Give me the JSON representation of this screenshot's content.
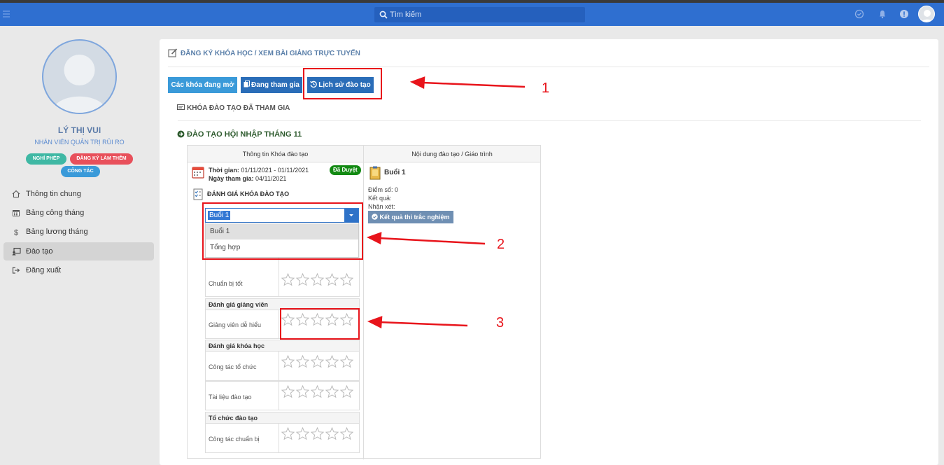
{
  "topbar": {
    "search_placeholder": "Tìm kiếm",
    "icons": [
      "menu-icon",
      "search-icon",
      "check-circle-icon",
      "bell-icon",
      "alert-icon",
      "user-avatar"
    ]
  },
  "profile": {
    "name": "LÝ THỊ VUI",
    "role": "NHÂN VIÊN QUẢN TRỊ RỦI RO",
    "badges": [
      {
        "label": "NGHỈ PHÉP",
        "color": "#3fb8a4"
      },
      {
        "label": "ĐĂNG KÝ LÀM THÊM",
        "color": "#e8505b"
      },
      {
        "label": "CÔNG TÁC",
        "color": "#3a9ad9"
      }
    ]
  },
  "nav": [
    {
      "label": "Thông tin chung",
      "icon": "home-icon",
      "active": false
    },
    {
      "label": "Bảng công tháng",
      "icon": "calendar-icon",
      "active": false
    },
    {
      "label": "Bảng lương tháng",
      "icon": "dollar-icon",
      "active": false
    },
    {
      "label": "Đào tạo",
      "icon": "training-icon",
      "active": true
    },
    {
      "label": "Đăng xuất",
      "icon": "logout-icon",
      "active": false
    }
  ],
  "breadcrumb": "ĐĂNG KÝ KHÓA HỌC / XEM BÀI GIẢNG TRỰC TUYẾN",
  "tabs": [
    {
      "label": "Các khóa đang mở",
      "color": "#3a9ad9"
    },
    {
      "label": "Đang tham gia",
      "color": "#2a6db8"
    },
    {
      "label": "Lịch sử đào tạo",
      "color": "#2a6db8"
    }
  ],
  "section_title": "KHÓA ĐÀO TẠO ĐÃ THAM GIA",
  "course": {
    "title": "ĐÀO TẠO HỘI NHẬP THÁNG 11",
    "col_info": "Thông tin Khóa đào tạo",
    "col_content": "Nội dung đào tạo / Giáo trình",
    "time_label": "Thời gian:",
    "time_value": "01/11/2021 - 01/11/2021",
    "join_label": "Ngày tham gia:",
    "join_value": "04/11/2021",
    "status": "Đã Duyệt",
    "status_color": "#138a13",
    "eval_title": "ĐÁNH GIÁ KHÓA ĐÀO TẠO",
    "select": {
      "value": "Buổi 1",
      "options": [
        "Buổi 1",
        "Tổng hợp"
      ]
    },
    "eval_groups": [
      {
        "category": "",
        "rows": [
          {
            "label": "Chuẩn bị tốt",
            "rating": 0
          }
        ]
      },
      {
        "category": "Đánh giá giảng viên",
        "rows": [
          {
            "label": "Giảng viên dễ hiểu",
            "rating": 0
          }
        ]
      },
      {
        "category": "Đánh giá khóa học",
        "rows": [
          {
            "label": "Công tác tổ chức",
            "rating": 0
          },
          {
            "label": "Tài liệu đào tạo",
            "rating": 0
          }
        ]
      },
      {
        "category": "Tổ chức đào tạo",
        "rows": [
          {
            "label": "Công tác chuẩn bị",
            "rating": 0
          }
        ]
      }
    ],
    "session": {
      "name": "Buổi 1",
      "score": "Điểm số: 0",
      "result": "Kết quả:",
      "comment": "Nhận xét:",
      "button": "Kết quả thi trắc nghiệm"
    }
  },
  "annotations": [
    "1",
    "2",
    "3"
  ],
  "annotation_color": "#e8141b"
}
